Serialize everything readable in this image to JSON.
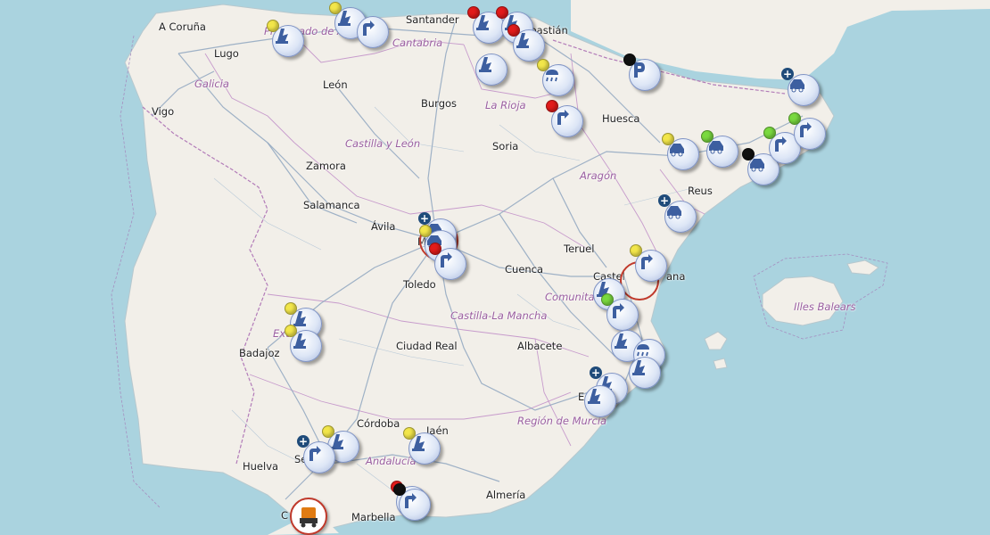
{
  "colors": {
    "sea": "#aad3df",
    "land": "#f2efe9",
    "road": "#8fa6bf",
    "border": "#b27bb8",
    "icon_glyph": "#3d5fa0"
  },
  "labels": [
    {
      "id": "a-coruna",
      "text": "A Coruña",
      "kind": "city"
    },
    {
      "id": "lugo",
      "text": "Lugo",
      "kind": "city"
    },
    {
      "id": "galicia",
      "text": "Galicia",
      "kind": "region"
    },
    {
      "id": "vigo",
      "text": "Vigo",
      "kind": "city"
    },
    {
      "id": "leon",
      "text": "León",
      "kind": "city"
    },
    {
      "id": "santander",
      "text": "Santander",
      "kind": "city"
    },
    {
      "id": "cantabria",
      "text": "Cantabria",
      "kind": "region"
    },
    {
      "id": "sebastian",
      "text": "Sebastián",
      "kind": "city"
    },
    {
      "id": "burgos",
      "text": "Burgos",
      "kind": "city"
    },
    {
      "id": "la-rioja",
      "text": "La Rioja",
      "kind": "region"
    },
    {
      "id": "huesca",
      "text": "Huesca",
      "kind": "city"
    },
    {
      "id": "castilla-leon",
      "text": "Castilla y León",
      "kind": "region"
    },
    {
      "id": "soria",
      "text": "Soria",
      "kind": "city"
    },
    {
      "id": "zamora",
      "text": "Zamora",
      "kind": "city"
    },
    {
      "id": "aragon",
      "text": "Aragón",
      "kind": "region"
    },
    {
      "id": "reus",
      "text": "Reus",
      "kind": "city"
    },
    {
      "id": "salamanca",
      "text": "Salamanca",
      "kind": "city"
    },
    {
      "id": "avila",
      "text": "Ávila",
      "kind": "city"
    },
    {
      "id": "teruel",
      "text": "Teruel",
      "kind": "city"
    },
    {
      "id": "cuenca",
      "text": "Cuenca",
      "kind": "city"
    },
    {
      "id": "toledo",
      "text": "Toledo",
      "kind": "city"
    },
    {
      "id": "comunita",
      "text": "Comunita",
      "kind": "region"
    },
    {
      "id": "castilla-mancha",
      "text": "Castilla-La Mancha",
      "kind": "region"
    },
    {
      "id": "illes-balears",
      "text": "Illes Balears",
      "kind": "region"
    },
    {
      "id": "badajoz",
      "text": "Badajoz",
      "kind": "city"
    },
    {
      "id": "ciudad-real",
      "text": "Ciudad Real",
      "kind": "city"
    },
    {
      "id": "albacete",
      "text": "Albacete",
      "kind": "city"
    },
    {
      "id": "region-murcia",
      "text": "Región de Murcia",
      "kind": "region"
    },
    {
      "id": "cordoba",
      "text": "Córdoba",
      "kind": "city"
    },
    {
      "id": "jaen",
      "text": "Jaén",
      "kind": "city"
    },
    {
      "id": "andalucia",
      "text": "Andalucía",
      "kind": "region"
    },
    {
      "id": "huelva",
      "text": "Huelva",
      "kind": "city"
    },
    {
      "id": "almeria",
      "text": "Almería",
      "kind": "city"
    },
    {
      "id": "marbella",
      "text": "Marbella",
      "kind": "city"
    },
    {
      "id": "ext",
      "text": "Ext",
      "kind": "region"
    },
    {
      "id": "castello-a",
      "text": "Castel",
      "kind": "city"
    },
    {
      "id": "castello-b",
      "text": "ana",
      "kind": "city"
    },
    {
      "id": "e",
      "text": "E",
      "kind": "city"
    },
    {
      "id": "so",
      "text": "Se",
      "kind": "city"
    },
    {
      "id": "c",
      "text": "C",
      "kind": "city"
    },
    {
      "id": "m",
      "text": "M",
      "kind": "city"
    },
    {
      "id": "prin",
      "text": "Principado de A",
      "kind": "region"
    }
  ],
  "incidents": [
    {
      "icon": "roadwork-icon",
      "status": "yellow"
    },
    {
      "icon": "roadwork-icon",
      "status": "yellow"
    },
    {
      "icon": "detour-icon",
      "status": "none"
    },
    {
      "icon": "roadwork-icon",
      "status": "red"
    },
    {
      "icon": "roadwork-icon",
      "status": "red"
    },
    {
      "icon": "roadwork-icon",
      "status": "red"
    },
    {
      "icon": "roadwork-icon",
      "status": "none"
    },
    {
      "icon": "weather-icon",
      "status": "yellow"
    },
    {
      "icon": "parking-icon",
      "status": "black"
    },
    {
      "icon": "accident-icon",
      "status": "plus"
    },
    {
      "icon": "detour-icon",
      "status": "red"
    },
    {
      "icon": "accident-icon",
      "status": "yellow"
    },
    {
      "icon": "accident-icon",
      "status": "green"
    },
    {
      "icon": "accident-icon",
      "status": "black"
    },
    {
      "icon": "detour-icon",
      "status": "green"
    },
    {
      "icon": "detour-icon",
      "status": "green"
    },
    {
      "icon": "accident-icon",
      "status": "plus"
    },
    {
      "icon": "accident-icon",
      "status": "plus"
    },
    {
      "icon": "accident-icon",
      "status": "yellow"
    },
    {
      "icon": "detour-icon",
      "status": "red"
    },
    {
      "icon": "detour-icon",
      "status": "yellow"
    },
    {
      "icon": "roadwork-icon",
      "status": "none"
    },
    {
      "icon": "detour-icon",
      "status": "green"
    },
    {
      "icon": "roadwork-icon",
      "status": "none"
    },
    {
      "icon": "weather-icon",
      "status": "none"
    },
    {
      "icon": "roadwork-icon",
      "status": "none"
    },
    {
      "icon": "roadwork-icon",
      "status": "plus"
    },
    {
      "icon": "roadwork-icon",
      "status": "none"
    },
    {
      "icon": "roadwork-icon",
      "status": "yellow"
    },
    {
      "icon": "roadwork-icon",
      "status": "yellow"
    },
    {
      "icon": "roadwork-icon",
      "status": "yellow"
    },
    {
      "icon": "detour-icon",
      "status": "plus"
    },
    {
      "icon": "roadwork-icon",
      "status": "yellow"
    },
    {
      "icon": "detour-icon",
      "status": "red"
    },
    {
      "icon": "detour-icon",
      "status": "black"
    },
    {
      "icon": "truck-icon",
      "status": "truck"
    }
  ]
}
